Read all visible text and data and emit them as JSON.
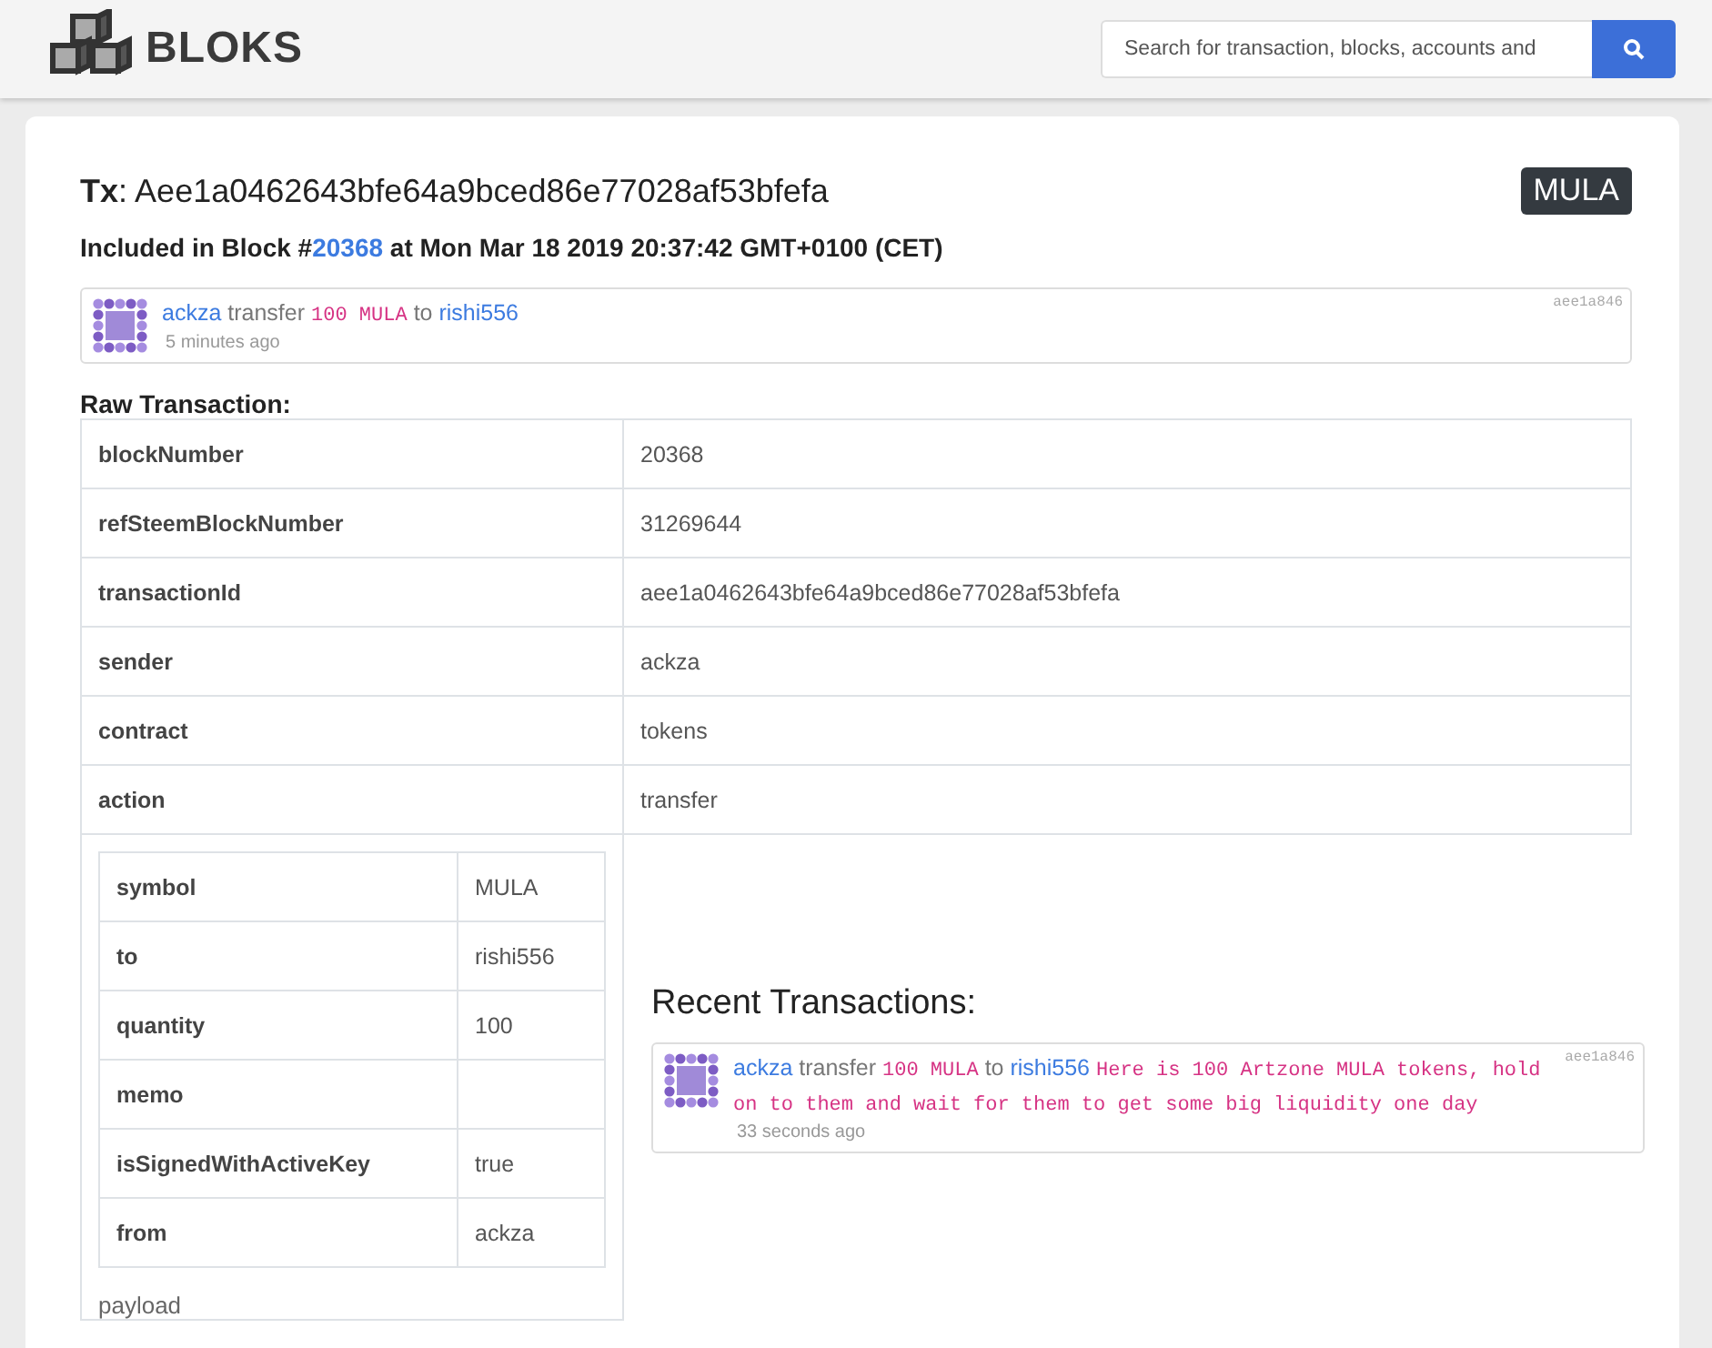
{
  "header": {
    "logo": "BLOKS",
    "search": {
      "placeholder": "Search for transaction, blocks, accounts and"
    }
  },
  "tx": {
    "label": "Tx",
    "separator": ":",
    "hash": "Aee1a0462643bfe64a9bced86e77028af53bfefa",
    "badge": "MULA",
    "included_prefix": "Included in Block #",
    "block": "20368",
    "included_suffix": "at Mon Mar 18 2019 20:37:42 GMT+0100 (CET)"
  },
  "activity": {
    "sender": "ackza",
    "action": "transfer",
    "amount": "100 MULA",
    "preposition": "to",
    "recipient": "rishi556",
    "short_hash": "aee1a846",
    "time": "5 minutes ago"
  },
  "raw": {
    "title": "Raw Transaction:",
    "rows": [
      {
        "key": "blockNumber",
        "value": "20368"
      },
      {
        "key": "refSteemBlockNumber",
        "value": "31269644"
      },
      {
        "key": "transactionId",
        "value": "aee1a0462643bfe64a9bced86e77028af53bfefa"
      },
      {
        "key": "sender",
        "value": "ackza"
      },
      {
        "key": "contract",
        "value": "tokens"
      },
      {
        "key": "action",
        "value": "transfer"
      }
    ],
    "payload_rows": [
      {
        "key": "symbol",
        "value": "MULA"
      },
      {
        "key": "to",
        "value": "rishi556"
      },
      {
        "key": "quantity",
        "value": "100"
      },
      {
        "key": "memo",
        "value": ""
      },
      {
        "key": "isSignedWithActiveKey",
        "value": "true"
      },
      {
        "key": "from",
        "value": "ackza"
      }
    ],
    "payload_label": "payload"
  },
  "recent": {
    "title": "Recent Transactions:",
    "items": [
      {
        "sender": "ackza",
        "action": "transfer",
        "amount": "100 MULA",
        "preposition": "to",
        "recipient": "rishi556",
        "memo": "Here is 100 Artzone MULA tokens, hold on to them and wait for them to get some big liquidity one day",
        "short_hash": "aee1a846",
        "time": "33 seconds ago"
      }
    ]
  }
}
